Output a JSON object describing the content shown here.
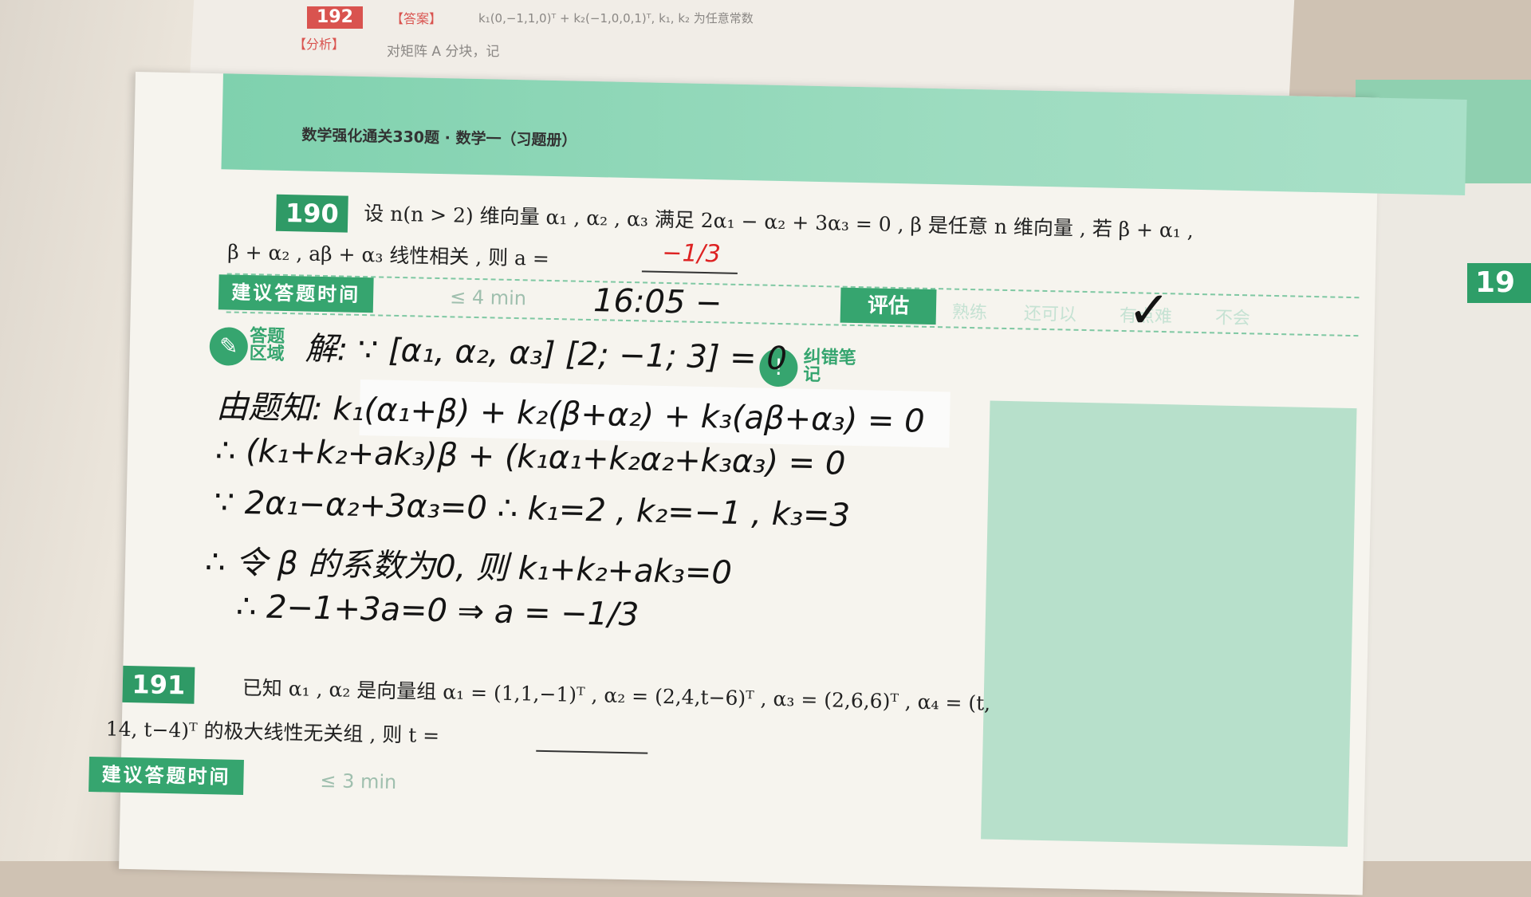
{
  "prev": {
    "number": "192",
    "answer_tag": "【答案】",
    "answer_text": "k₁(0,−1,1,0)ᵀ + k₂(−1,0,0,1)ᵀ, k₁, k₂ 为任意常数",
    "analysis_tag": "【分析】",
    "analysis_text": "对矩阵 A 分块，记"
  },
  "header": {
    "title": "数学强化通关330题 · 数学一（习题册）"
  },
  "q190": {
    "number": "190",
    "line1": "设 n(n > 2) 维向量 α₁ , α₂ , α₃ 满足 2α₁ − α₂ + 3α₃ = 0 , β 是任意 n 维向量 , 若 β + α₁ ,",
    "line2": "β + α₂ , aβ + α₃ 线性相关 , 则 a =",
    "answer": "−1/3",
    "time_label": "建议答题时间",
    "time_limit": "≤ 4 min",
    "written_time": "16:05 −",
    "eval_label": "评估",
    "eval_options": [
      "熟练",
      "还可以",
      "有点难",
      "不会"
    ],
    "eval_check": "✓",
    "answer_area_label": "答题区域",
    "note_label": "纠错笔记"
  },
  "solution": {
    "l1": "解: ∵ [α₁, α₂, α₃] [2; −1; 3] = 0",
    "l2": "由题知:  k₁(α₁+β) + k₂(β+α₂) + k₃(aβ+α₃) = 0",
    "l3": "∴ (k₁+k₂+ak₃)β + (k₁α₁+k₂α₂+k₃α₃) = 0",
    "l4": "∵ 2α₁−α₂+3α₃=0   ∴ k₁=2 , k₂=−1 , k₃=3",
    "l5": "∴ 令 β 的系数为0, 则 k₁+k₂+ak₃=0",
    "l6": "∴ 2−1+3a=0  ⇒  a = −1/3"
  },
  "q191": {
    "number": "191",
    "line1": "已知 α₁ , α₂ 是向量组 α₁ = (1,1,−1)ᵀ , α₂ = (2,4,t−6)ᵀ , α₃ = (2,6,6)ᵀ , α₄ = (t,",
    "line2": "14, t−4)ᵀ 的极大线性无关组 , 则 t =",
    "time_label": "建议答题时间",
    "time_limit": "≤ 3 min"
  },
  "right_page": {
    "number": "19"
  }
}
